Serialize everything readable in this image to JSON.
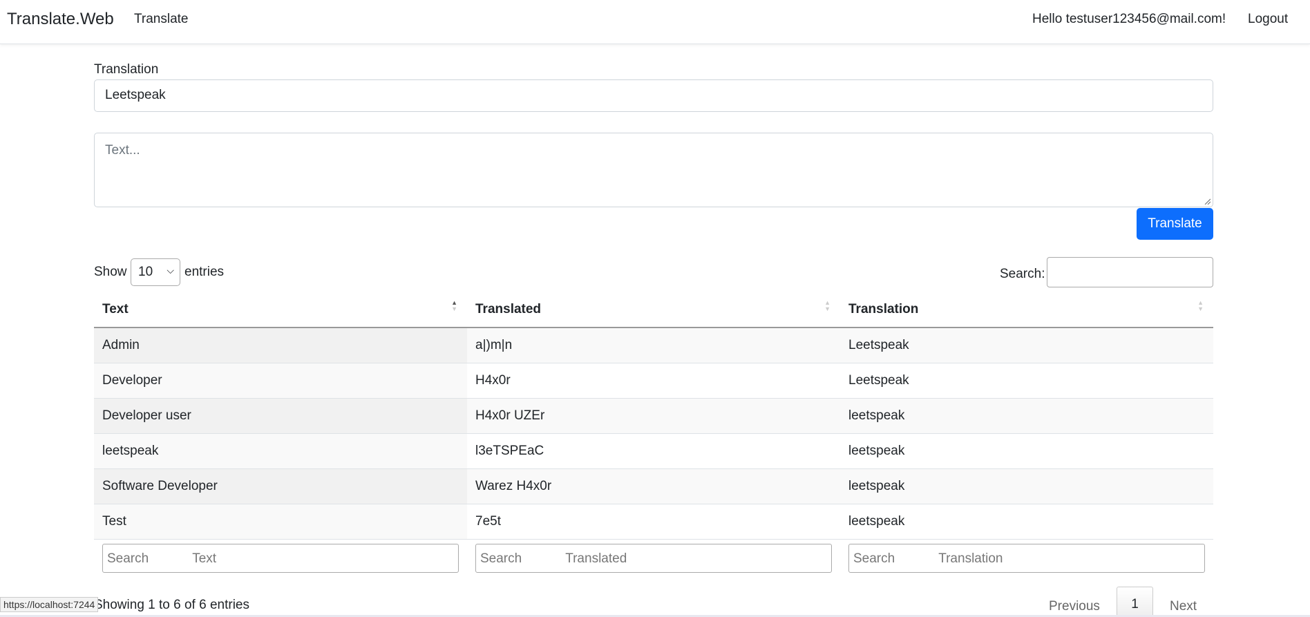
{
  "navbar": {
    "brand": "Translate.Web",
    "nav_translate": "Translate",
    "greeting": "Hello testuser123456@mail.com!",
    "logout": "Logout"
  },
  "form": {
    "translation_label": "Translation",
    "translation_value": "Leetspeak",
    "text_placeholder": "Text...",
    "translate_button": "Translate"
  },
  "table_controls": {
    "show_label": "Show",
    "page_size": "10",
    "entries_label": "entries",
    "search_label": "Search:"
  },
  "table": {
    "columns": [
      "Text",
      "Translated",
      "Translation"
    ],
    "rows": [
      [
        "Admin",
        "a|)m|n",
        "Leetspeak"
      ],
      [
        "Developer",
        "H4x0r",
        "Leetspeak"
      ],
      [
        "Developer user",
        "H4x0r UZEr",
        "leetspeak"
      ],
      [
        "leetspeak",
        "l3eTSPEaC",
        "leetspeak"
      ],
      [
        "Software Developer",
        "Warez H4x0r",
        "leetspeak"
      ],
      [
        "Test",
        "7e5t",
        "leetspeak"
      ]
    ],
    "footer_search": [
      "Search            Text",
      "Search            Translated",
      "Search            Translation"
    ]
  },
  "pagination": {
    "info": "Showing 1 to 6 of 6 entries",
    "previous": "Previous",
    "current_page": "1",
    "next": "Next"
  },
  "status_bar": {
    "url": "https://localhost:7244"
  },
  "colors": {
    "primary": "#0d6efd"
  }
}
